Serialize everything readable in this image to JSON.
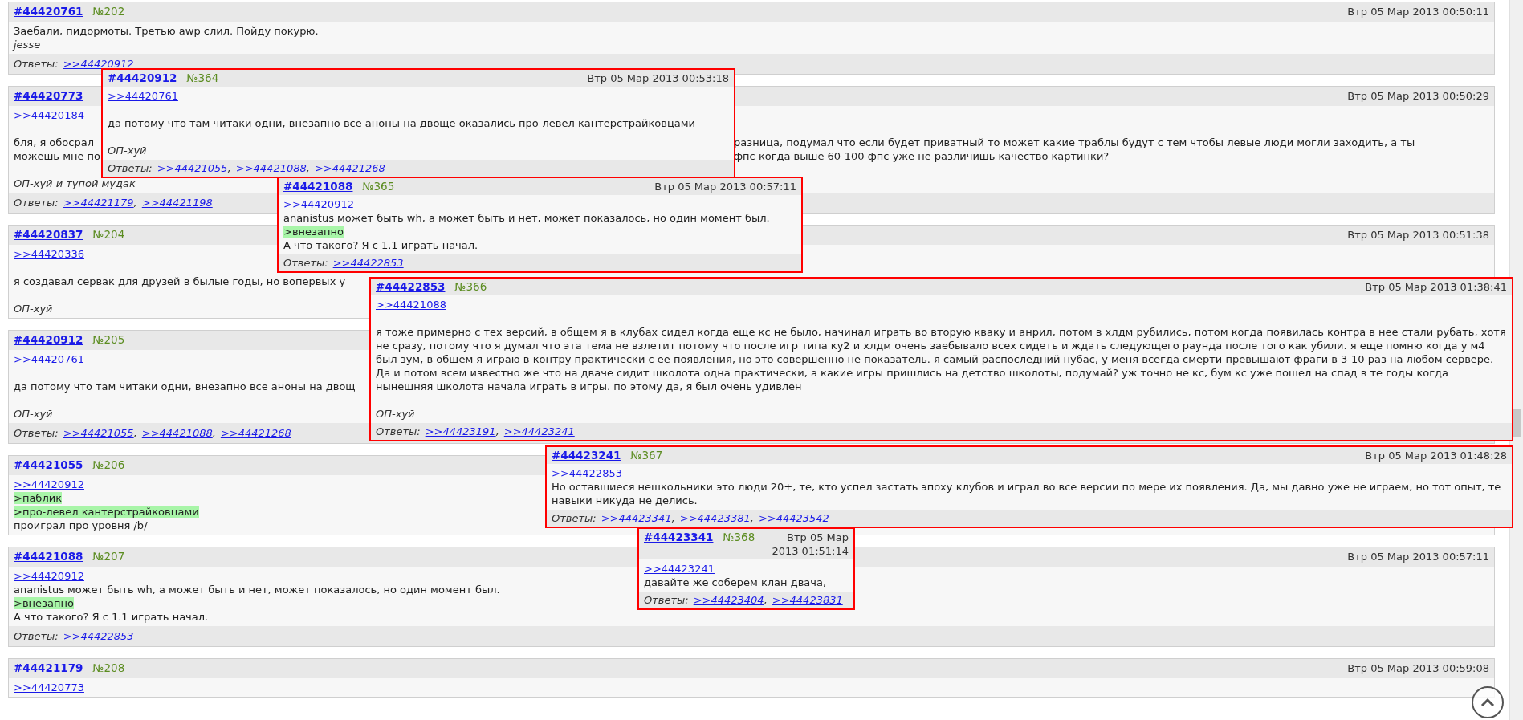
{
  "posts": [
    {
      "id": "#44420761",
      "num": "№202",
      "date": "Втр 05 Мар 2013 00:50:11",
      "lines": [
        {
          "kind": "text",
          "text": "Заебали, пидормоты. Третью awp слил. Пойду покурю."
        },
        {
          "kind": "sign",
          "text": "jesse"
        }
      ],
      "replies_label": "Ответы:",
      "replies": [
        ">>44420912"
      ]
    },
    {
      "id": "#44420773",
      "date": "Втр 05 Мар 2013 00:50:29",
      "lines": [
        {
          "kind": "ref",
          "text": ">>44420184"
        },
        {
          "kind": "gap"
        },
        {
          "kind": "split",
          "parts": [
            "бля, я обосрал",
            "разница, подумал что если будет приватный то может какие траблы будут с тем чтобы левые люди могли заходить, а ты"
          ]
        },
        {
          "kind": "split",
          "parts": [
            "можешь мне по",
            "фпс когда выше 60-100 фпс уже не различишь качество картинки?"
          ]
        },
        {
          "kind": "gap"
        },
        {
          "kind": "sign",
          "text": "ОП-хуй и тупой мудак"
        }
      ],
      "replies_label": "Ответы:",
      "replies": [
        ">>44421179",
        ">>44421198"
      ],
      "separator": ","
    },
    {
      "id": "#44420837",
      "num": "№204",
      "date": "Втр 05 Мар 2013 00:51:38",
      "lines": [
        {
          "kind": "ref",
          "text": ">>44420336"
        },
        {
          "kind": "gap"
        },
        {
          "kind": "text",
          "text": "я создавал сервак для друзей в былые годы, но вопервых у"
        },
        {
          "kind": "gap"
        },
        {
          "kind": "sign",
          "text": "ОП-хуй"
        }
      ]
    },
    {
      "id": "#44420912",
      "num": "№205",
      "lines": [
        {
          "kind": "ref",
          "text": ">>44420761"
        },
        {
          "kind": "gap"
        },
        {
          "kind": "text",
          "text": "да потому что там читаки одни, внезапно все аноны на двощ"
        },
        {
          "kind": "gap"
        },
        {
          "kind": "sign",
          "text": "ОП-хуй"
        }
      ],
      "replies_label": "Ответы:",
      "replies": [
        ">>44421055",
        ">>44421088",
        ">>44421268"
      ],
      "separator": ","
    },
    {
      "id": "#44421055",
      "num": "№206",
      "lines": [
        {
          "kind": "ref",
          "text": ">>44420912"
        },
        {
          "kind": "quote",
          "text": ">паблик"
        },
        {
          "kind": "quote",
          "text": ">про-левел кантерстрайковцами"
        },
        {
          "kind": "text",
          "text": "проиграл про уровня /b/"
        }
      ]
    },
    {
      "id": "#44421088",
      "num": "№207",
      "date": "Втр 05 Мар 2013 00:57:11",
      "lines": [
        {
          "kind": "ref",
          "text": ">>44420912"
        },
        {
          "kind": "text",
          "text": "ananistus может быть wh, а может быть и нет, может показалось, но один момент был."
        },
        {
          "kind": "quote",
          "text": ">внезапно"
        },
        {
          "kind": "text",
          "text": "А что такого? Я с 1.1 играть начал."
        }
      ],
      "replies_label": "Ответы:",
      "replies": [
        ">>44422853"
      ]
    },
    {
      "id": "#44421179",
      "num": "№208",
      "date": "Втр 05 Мар 2013 00:59:08",
      "lines": [
        {
          "kind": "ref",
          "text": ">>44420773"
        }
      ]
    }
  ],
  "popups": [
    {
      "id": "#44420912",
      "num": "№364",
      "date": "Втр 05 Мар 2013 00:53:18",
      "lines": [
        {
          "kind": "ref",
          "text": ">>44420761"
        },
        {
          "kind": "gap"
        },
        {
          "kind": "text",
          "text": "да потому что там читаки одни, внезапно все аноны на двоще оказались про-левел кантерстрайковцами"
        },
        {
          "kind": "gap"
        },
        {
          "kind": "sign",
          "text": "ОП-хуй"
        }
      ],
      "replies_label": "Ответы:",
      "replies": [
        ">>44421055",
        ">>44421088",
        ">>44421268"
      ],
      "separator": ","
    },
    {
      "id": "#44421088",
      "num": "№365",
      "date": "Втр 05 Мар 2013 00:57:11",
      "lines": [
        {
          "kind": "ref",
          "text": ">>44420912"
        },
        {
          "kind": "text",
          "text": "ananistus может быть wh, а может быть и нет, может показалось, но один момент был."
        },
        {
          "kind": "quote",
          "text": ">внезапно"
        },
        {
          "kind": "text",
          "text": "А что такого? Я с 1.1 играть начал."
        }
      ],
      "replies_label": "Ответы:",
      "replies": [
        ">>44422853"
      ]
    },
    {
      "id": "#44422853",
      "num": "№366",
      "date": "Втр 05 Мар 2013 01:38:41",
      "lines": [
        {
          "kind": "ref",
          "text": ">>44421088"
        },
        {
          "kind": "gap"
        },
        {
          "kind": "text",
          "text": "я тоже примерно с тех версий, в общем я в клубах сидел когда еще кс не было, начинал играть во вторую кваку и анрил, потом в хлдм рубились, потом когда появилась контра в нее стали рубать, хотя не сразу, потому что я думал что эта тема не взлетит потому что после игр типа ку2 и хлдм очень заебывало всех сидеть и ждать следующего раунда после того как убили. я еще помню когда у м4 был зум, в общем я играю в контру практически с ее появления, но это совершенно не показатель. я самый распоследний нубас, у меня всегда смерти превышают фраги в 3-10 раз на любом сервере. Да и потом всем известно же что на дваче сидит школота одна практически, а какие игры пришлись на детство школоты, подумай? уж точно не кс, бум кс уже пошел на спад в те годы когда нынешняя школота начала играть в игры. по этому да, я был очень удивлен"
        },
        {
          "kind": "gap"
        },
        {
          "kind": "sign",
          "text": "ОП-хуй"
        }
      ],
      "replies_label": "Ответы:",
      "replies": [
        ">>44423191",
        ">>44423241"
      ],
      "separator": ","
    },
    {
      "id": "#44423241",
      "num": "№367",
      "date": "Втр 05 Мар 2013 01:48:28",
      "lines": [
        {
          "kind": "ref",
          "text": ">>44422853"
        },
        {
          "kind": "text",
          "text": "Но оставшиеся нешкольники это люди 20+, те, кто успел застать эпоху клубов и играл во все версии по мере их появления. Да, мы давно уже не играем, но тот опыт, те навыки никуда не делись."
        }
      ],
      "replies_label": "Ответы:",
      "replies": [
        ">>44423341",
        ">>44423381",
        ">>44423542"
      ],
      "separator": ","
    },
    {
      "id": "#44423341",
      "num": "№368",
      "date": "Втр 05 Мар 2013 01:51:14",
      "lines": [
        {
          "kind": "ref",
          "text": ">>44423241"
        },
        {
          "kind": "text",
          "text": "давайте же соберем клан двача,"
        }
      ],
      "replies_label": "Ответы:",
      "replies": [
        ">>44423404",
        ">>44423831"
      ],
      "separator": ","
    }
  ]
}
